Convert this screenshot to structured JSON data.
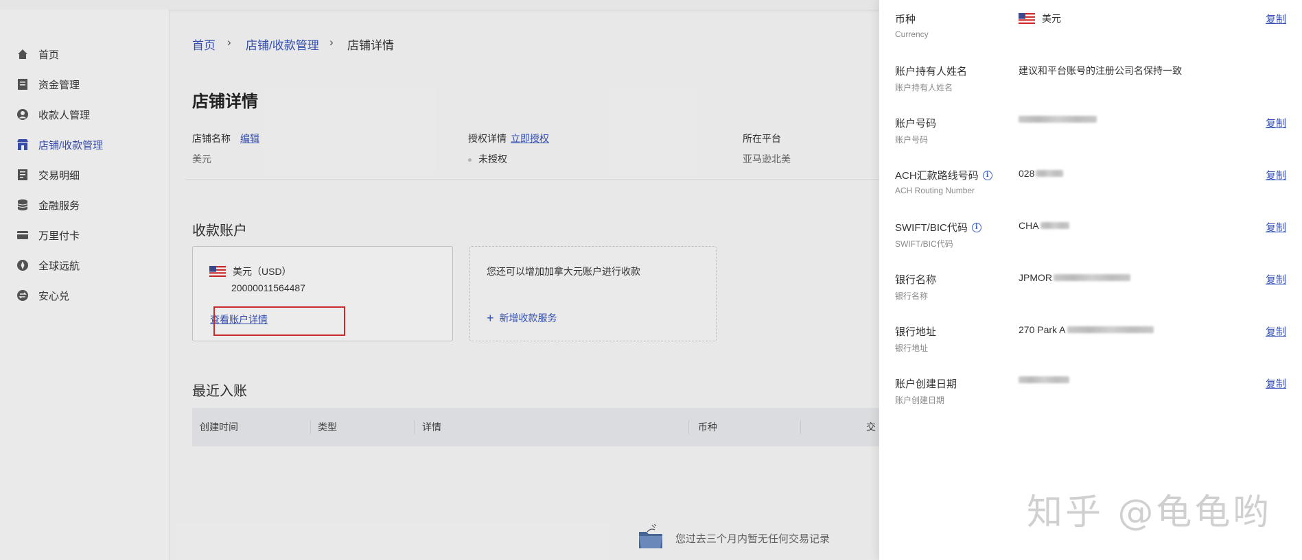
{
  "sidebar": {
    "items": [
      {
        "label": "首页",
        "icon": "home-icon"
      },
      {
        "label": "资金管理",
        "icon": "ledger-icon"
      },
      {
        "label": "收款人管理",
        "icon": "user-circle-icon"
      },
      {
        "label": "店铺/收款管理",
        "icon": "store-icon",
        "active": true
      },
      {
        "label": "交易明细",
        "icon": "document-list-icon"
      },
      {
        "label": "金融服务",
        "icon": "database-icon"
      },
      {
        "label": "万里付卡",
        "icon": "card-icon"
      },
      {
        "label": "全球远航",
        "icon": "compass-icon"
      },
      {
        "label": "安心兑",
        "icon": "exchange-icon"
      }
    ]
  },
  "breadcrumb": {
    "home": "首页",
    "sep": "›",
    "parent": "店铺/收款管理",
    "current": "店铺详情"
  },
  "page": {
    "title": "店铺详情"
  },
  "store_info": {
    "name_label": "店铺名称",
    "name_edit": "编辑",
    "name_value": "美元",
    "auth_label": "授权详情",
    "auth_action": "立即授权",
    "auth_value": "未授权",
    "platform_label": "所在平台",
    "platform_value": "亚马逊北美"
  },
  "accounts": {
    "section_title": "收款账户",
    "usd_card": {
      "currency": "美元（USD）",
      "account_number": "20000011564487",
      "view_detail": "查看账户详情"
    },
    "add_card": {
      "text": "您还可以增加加拿大元账户进行收款",
      "action": "新增收款服务"
    }
  },
  "recent": {
    "section_title": "最近入账",
    "columns": [
      "创建时间",
      "类型",
      "详情",
      "币种",
      "交"
    ],
    "empty_text": "您过去三个月内暂无任何交易记录"
  },
  "drawer": {
    "copy_label": "复制",
    "rows": [
      {
        "label": "币种",
        "sub": "Currency",
        "value": "美元",
        "copy": true
      },
      {
        "label": "账户持有人姓名",
        "sub": "账户持有人姓名",
        "value": "建议和平台账号的注册公司名保持一致",
        "copy": false
      },
      {
        "label": "账户号码",
        "sub": "账户号码",
        "value": "",
        "copy": true
      },
      {
        "label": "ACH汇款路线号码",
        "sub": "ACH Routing Number",
        "value": "028",
        "copy": true,
        "info": true
      },
      {
        "label": "SWIFT/BIC代码",
        "sub": "SWIFT/BIC代码",
        "value": "CHA",
        "copy": true,
        "info": true
      },
      {
        "label": "银行名称",
        "sub": "银行名称",
        "value": "JPMOR",
        "copy": true
      },
      {
        "label": "银行地址",
        "sub": "银行地址",
        "value": "270 Park A",
        "copy": true
      },
      {
        "label": "账户创建日期",
        "sub": "账户创建日期",
        "value": "",
        "copy": true
      }
    ]
  },
  "watermark": {
    "text": "知乎 @龟龟哟"
  },
  "colors": {
    "accent": "#3550b8",
    "highlight_box": "#d12b2b"
  }
}
